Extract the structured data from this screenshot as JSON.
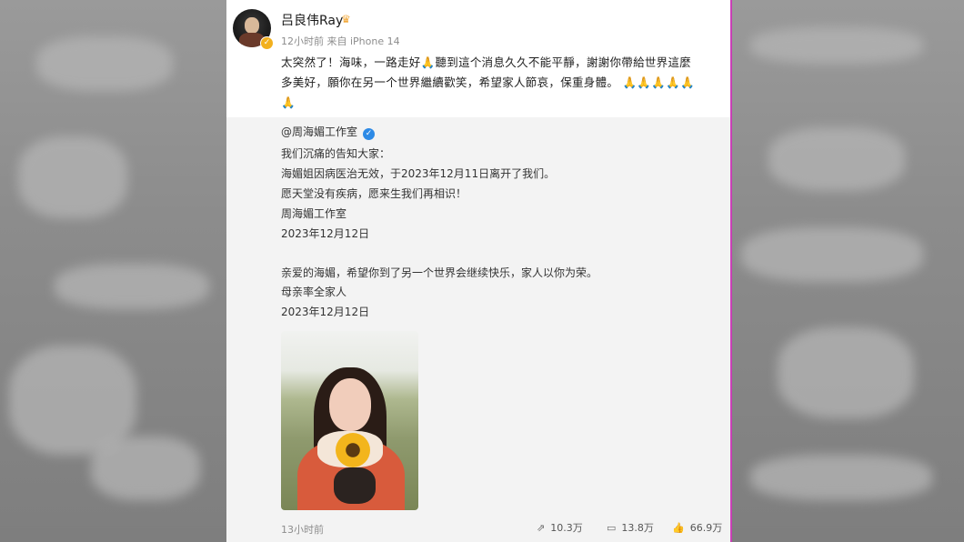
{
  "post": {
    "username": "吕良伟Ray",
    "crown_icon": "crown-icon",
    "meta": "12小时前  来自 iPhone 14",
    "text_line1_a": "太突然了！海味，一路走好",
    "text_line1_b": "聽到這个消息久久不能平靜，謝謝你帶給世界這麼",
    "text_line2": "多美好，願你在另一个世界繼續歡笑，希望家人節哀，保重身體。",
    "emoji": "🙏"
  },
  "repost": {
    "author": "@周海媚工作室",
    "lines": [
      "我们沉痛的告知大家：",
      "海媚姐因病医治无效，于2023年12月11日离开了我们。",
      "愿天堂没有疾病，愿来生我们再相识！",
      "周海媚工作室",
      "2023年12月12日",
      "亲爱的海媚，希望你到了另一个世界会继续快乐，家人以你为荣。",
      "母亲率全家人",
      "2023年12月12日"
    ],
    "time": "13小时前",
    "stats": {
      "reposts": "10.3万",
      "comments": "13.8万",
      "likes": "66.9万"
    }
  },
  "colors": {
    "accent_border": "#c93fb6",
    "verified_blue": "#2d8ae6",
    "vip_gold": "#f2b01e"
  }
}
